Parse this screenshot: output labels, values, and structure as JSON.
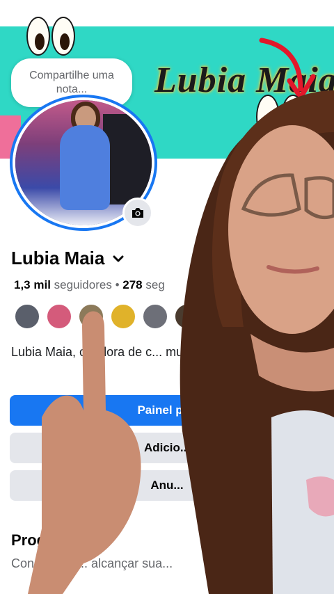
{
  "note": {
    "placeholder": "Compartilhe uma nota..."
  },
  "cover": {
    "title": "Lubia Maia"
  },
  "profile": {
    "name": "Lubia Maia",
    "followers_count": "1,3 mil",
    "followers_label": "seguidores",
    "separator": "•",
    "following_count": "278",
    "following_label": "seg",
    "bio": "Lubia Maia, criadora de c... muito bem-vindos ao me..."
  },
  "buttons": {
    "primary": "Painel pr...",
    "add": "Adicio...",
    "ads": "Anu..."
  },
  "progress": {
    "title": "Progresso",
    "description": "Conclua as ... alcançar sua..."
  },
  "icons": {
    "camera": "camera-icon",
    "chevron": "chevron-down-icon",
    "arrow": "red-arrow-icon",
    "eyes": "googly-eyes-icon"
  },
  "colors": {
    "accent": "#1877f2",
    "cover": "#2fd8c5",
    "arrow": "#e2182b"
  }
}
